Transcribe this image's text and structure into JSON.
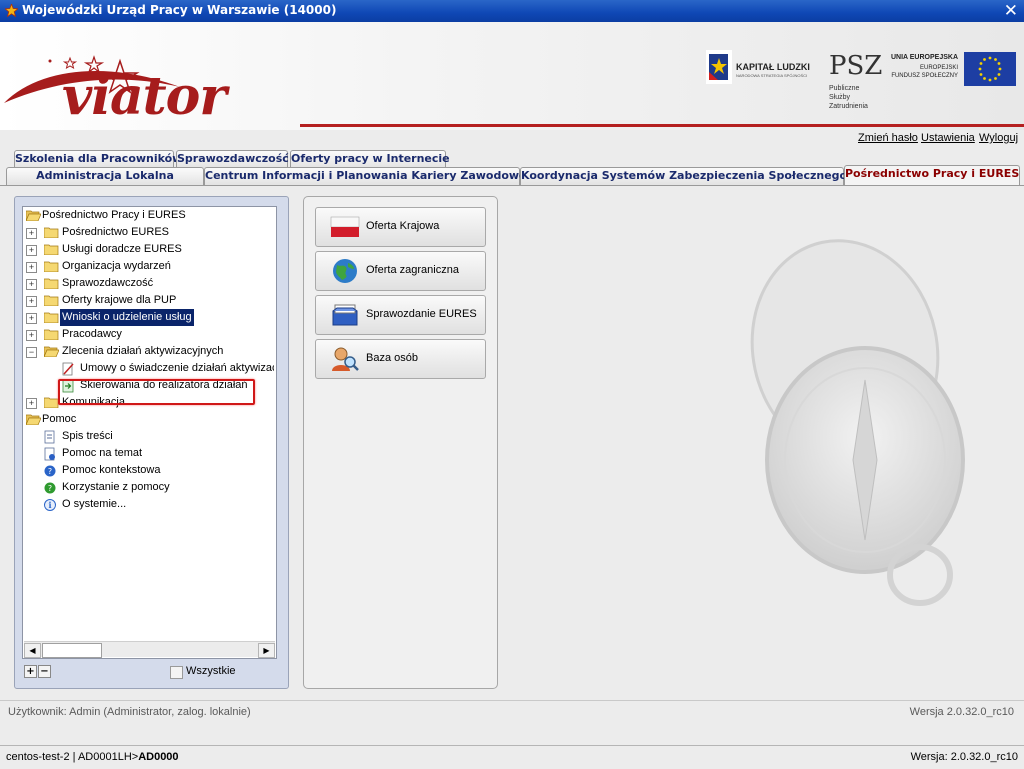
{
  "window": {
    "title": "Wojewódzki Urząd Pracy w Warszawie (14000)",
    "close_glyph": "✕"
  },
  "header": {
    "logo_text": "viator",
    "kapital_ludzki": "KAPITAŁ LUDZKI",
    "kapital_sub": "NARODOWA STRATEGIA SPÓJNOŚCI",
    "psz": "PSZ",
    "psz_lines": [
      "Publiczne",
      "Służby",
      "Zatrudnienia"
    ],
    "eu_title": "UNIA EUROPEJSKA",
    "eu_lines": [
      "EUROPEJSKI",
      "FUNDUSZ SPOŁECZNY"
    ]
  },
  "toplinks": {
    "change_password": "Zmień hasło",
    "settings": "Ustawienia",
    "logout": "Wyloguj"
  },
  "tabs_row1": [
    {
      "label": "Szkolenia dla Pracowników"
    },
    {
      "label": "Sprawozdawczość"
    },
    {
      "label": "Oferty pracy w Internecie"
    }
  ],
  "tabs_row2": [
    {
      "label": "Administracja Lokalna"
    },
    {
      "label": "Centrum Informacji i Planowania Kariery Zawodowej"
    },
    {
      "label": "Koordynacja Systemów Zabezpieczenia Społecznego"
    },
    {
      "label": "Pośrednictwo Pracy i EURES",
      "active": true
    }
  ],
  "tree": {
    "root": "Pośrednictwo Pracy i EURES",
    "items": [
      "Pośrednictwo EURES",
      "Usługi doradcze EURES",
      "Organizacja wydarzeń",
      "Sprawozdawczość",
      "Oferty krajowe dla PUP",
      "Wnioski o udzielenie usług",
      "Pracodawcy",
      "Zlecenia działań aktywizacyjnych"
    ],
    "sub_items": [
      "Umowy o świadczenie działań aktywizacyjnych",
      "Skierowania do realizatora działań"
    ],
    "after": "Komunikacja",
    "help_root": "Pomoc",
    "help_items": [
      "Spis treści",
      "Pomoc na temat",
      "Pomoc kontekstowa",
      "Korzystanie z pomocy",
      "O systemie..."
    ]
  },
  "tree_footer": {
    "plus": "+",
    "minus": "−",
    "all_label": "Wszystkie"
  },
  "buttons": [
    {
      "label": "Oferta Krajowa",
      "icon": "poland-flag-icon"
    },
    {
      "label": "Oferta zagraniczna",
      "icon": "globe-icon"
    },
    {
      "label": "Sprawozdanie EURES",
      "icon": "report-icon"
    },
    {
      "label": "Baza osób",
      "icon": "people-search-icon"
    }
  ],
  "status": {
    "user": "Użytkownik: Admin (Administrator, zalog. lokalnie)",
    "version_right": "Wersja 2.0.32.0_rc10",
    "host": "centos-test-2 | AD0001LH>",
    "host_bold": "AD0000",
    "version_bottom": "Wersja: 2.0.32.0_rc10"
  }
}
